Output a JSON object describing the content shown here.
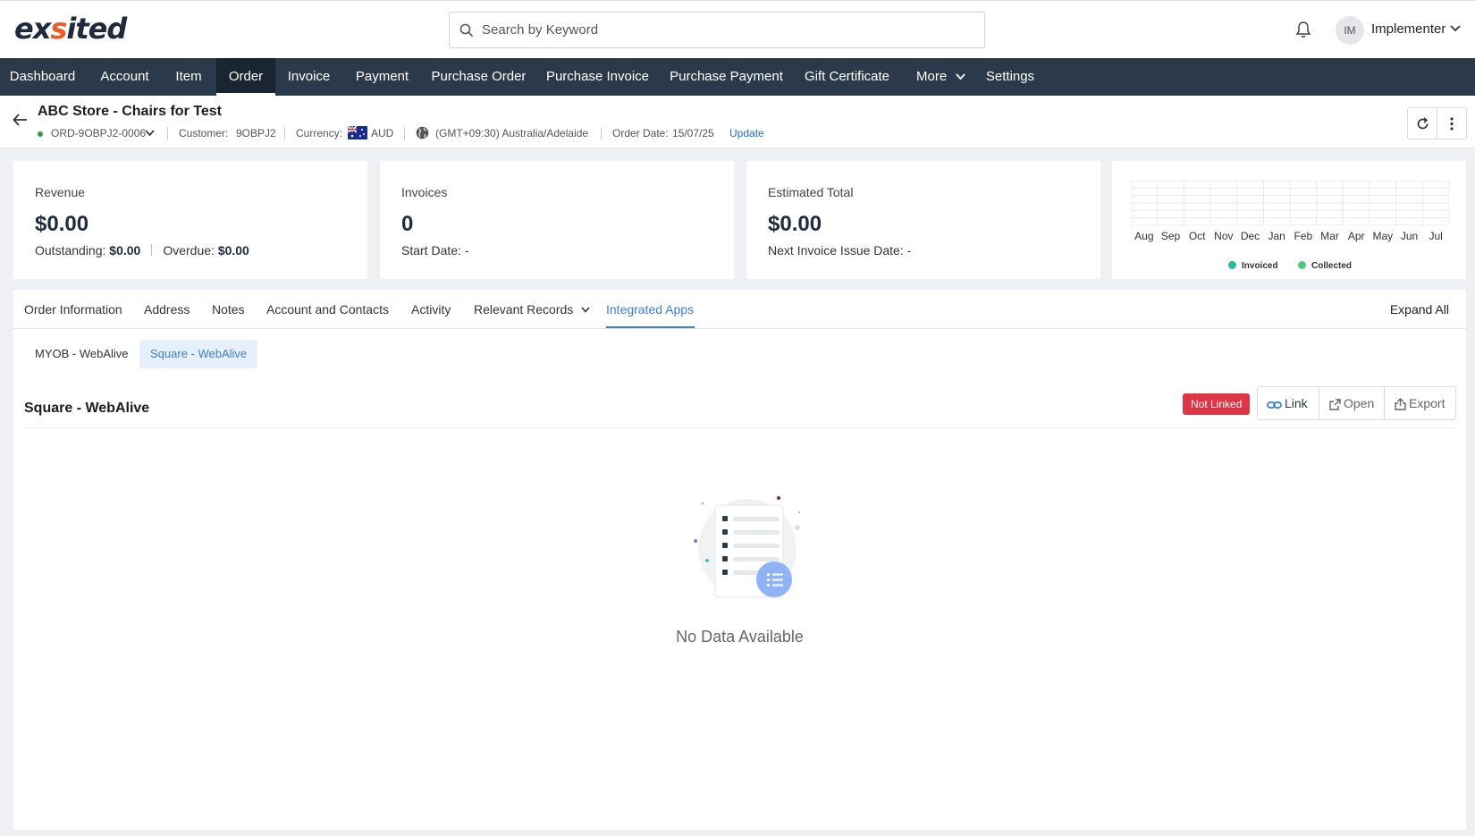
{
  "app": {
    "logo_left": "ex",
    "logo_accent": "s",
    "logo_right": "ited"
  },
  "search": {
    "placeholder": "Search by Keyword"
  },
  "user": {
    "initials": "IM",
    "name": "Implementer"
  },
  "nav": {
    "items": [
      "Dashboard",
      "Account",
      "Item",
      "Order",
      "Invoice",
      "Payment",
      "Purchase Order",
      "Purchase Invoice",
      "Purchase Payment",
      "Gift Certificate",
      "More",
      "Settings"
    ],
    "active": "Order"
  },
  "order": {
    "title": "ABC Store - Chairs for Test",
    "number": "ORD-9OBPJ2-0006",
    "customer_label": "Customer:",
    "customer_value": "9OBPJ2",
    "currency_label": "Currency:",
    "currency_value": "AUD",
    "timezone": "(GMT+09:30) Australia/Adelaide",
    "date_label": "Order Date:",
    "date_value": "15/07/25",
    "update_label": "Update"
  },
  "cards": {
    "revenue": {
      "label": "Revenue",
      "value": "$0.00",
      "outstanding_label": "Outstanding:",
      "outstanding_value": "$0.00",
      "overdue_label": "Overdue:",
      "overdue_value": "$0.00"
    },
    "invoices": {
      "label": "Invoices",
      "value": "0",
      "sub": "Start Date: -"
    },
    "estimated": {
      "label": "Estimated Total",
      "value": "$0.00",
      "sub": "Next Invoice Issue Date: -"
    }
  },
  "chart_data": {
    "type": "bar",
    "categories": [
      "Aug",
      "Sep",
      "Oct",
      "Nov",
      "Dec",
      "Jan",
      "Feb",
      "Mar",
      "Apr",
      "May",
      "Jun",
      "Jul"
    ],
    "series": [
      {
        "name": "Invoiced",
        "values": [
          0,
          0,
          0,
          0,
          0,
          0,
          0,
          0,
          0,
          0,
          0,
          0
        ],
        "color": "#2bb5a6"
      },
      {
        "name": "Collected",
        "values": [
          0,
          0,
          0,
          0,
          0,
          0,
          0,
          0,
          0,
          0,
          0,
          0
        ],
        "color": "#4fca7a"
      }
    ],
    "title": "",
    "xlabel": "",
    "ylabel": "",
    "grid": true,
    "legend": "bottom"
  },
  "tabs": {
    "items": [
      "Order Information",
      "Address",
      "Notes",
      "Account and Contacts",
      "Activity",
      "Relevant Records",
      "Integrated Apps"
    ],
    "active": "Integrated Apps",
    "expand_all": "Expand All"
  },
  "subtabs": {
    "items": [
      "MYOB - WebAlive",
      "Square - WebAlive"
    ],
    "active": "Square - WebAlive"
  },
  "integration": {
    "title": "Square - WebAlive",
    "status": "Not Linked",
    "status_color": "#dc3545",
    "link_label": "Link",
    "open_label": "Open",
    "export_label": "Export",
    "empty_text": "No Data Available"
  },
  "colors": {
    "nav_bg": "#2b3a4b",
    "accent": "#3b7fd4",
    "logo_accent": "#f05a28"
  }
}
